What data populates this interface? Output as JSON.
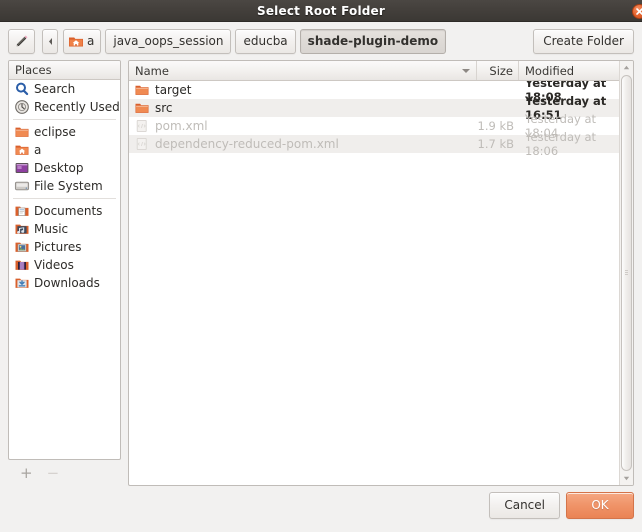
{
  "window": {
    "title": "Select Root Folder",
    "close_icon": "close-icon"
  },
  "toolbar": {
    "location_toggle_icon": "pencil-icon",
    "back_icon": "chevron-left-icon",
    "create_folder_label": "Create Folder",
    "path_buttons": [
      {
        "label": "a",
        "icon": "home-folder-icon",
        "active": false
      },
      {
        "label": "java_oops_session",
        "icon": "",
        "active": false
      },
      {
        "label": "educba",
        "icon": "",
        "active": false
      },
      {
        "label": "shade-plugin-demo",
        "icon": "",
        "active": true
      }
    ]
  },
  "sidebar": {
    "header": "Places",
    "groups": [
      [
        {
          "label": "Search",
          "icon": "search-icon"
        },
        {
          "label": "Recently Used",
          "icon": "recent-clock-icon"
        }
      ],
      [
        {
          "label": "eclipse",
          "icon": "folder-icon"
        },
        {
          "label": "a",
          "icon": "home-folder-icon"
        },
        {
          "label": "Desktop",
          "icon": "desktop-icon"
        },
        {
          "label": "File System",
          "icon": "drive-icon"
        }
      ],
      [
        {
          "label": "Documents",
          "icon": "documents-icon"
        },
        {
          "label": "Music",
          "icon": "music-icon"
        },
        {
          "label": "Pictures",
          "icon": "pictures-icon"
        },
        {
          "label": "Videos",
          "icon": "videos-icon"
        },
        {
          "label": "Downloads",
          "icon": "downloads-icon"
        }
      ]
    ],
    "add_label": "+",
    "remove_label": "−"
  },
  "filelist": {
    "columns": {
      "name": "Name",
      "size": "Size",
      "modified": "Modified"
    },
    "sort_indicator": "sort-descending-icon",
    "rows": [
      {
        "name": "target",
        "size": "",
        "modified": "Yesterday at 18:08",
        "icon": "folder-icon",
        "dim": false,
        "alt": false
      },
      {
        "name": "src",
        "size": "",
        "modified": "Yesterday at 16:51",
        "icon": "folder-icon",
        "dim": false,
        "alt": true
      },
      {
        "name": "pom.xml",
        "size": "1.9 kB",
        "modified": "Yesterday at 18:04",
        "icon": "xml-file-icon",
        "dim": true,
        "alt": false
      },
      {
        "name": "dependency-reduced-pom.xml",
        "size": "1.7 kB",
        "modified": "Yesterday at 18:06",
        "icon": "xml-file-icon",
        "dim": true,
        "alt": true
      }
    ]
  },
  "footer": {
    "cancel_label": "Cancel",
    "ok_label": "OK"
  },
  "colors": {
    "titlebar": "#433f3b",
    "accent_ok": "#ef8f63",
    "folder": "#e8703a",
    "panel_bg": "#ffffff",
    "window_bg": "#f2f1f0"
  }
}
